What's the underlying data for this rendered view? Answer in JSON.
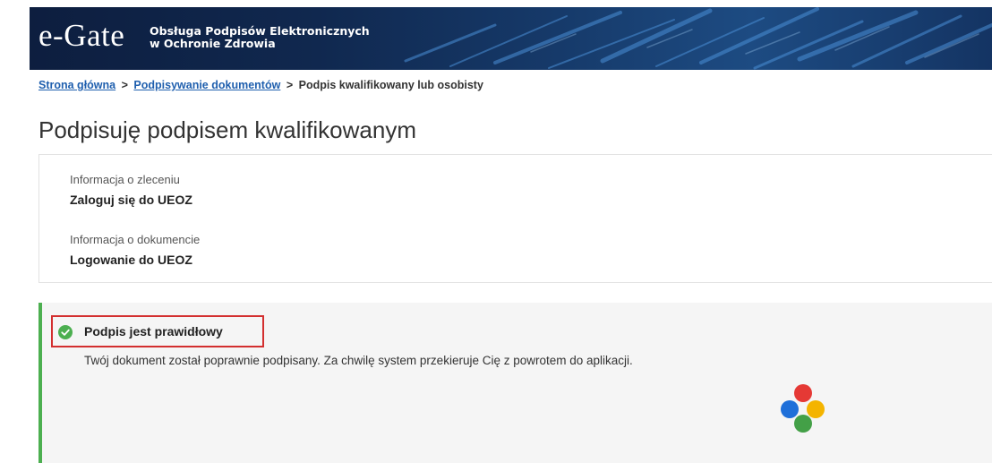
{
  "header": {
    "logo": "e-Gate",
    "subtitle_line1": "Obsługa Podpisów Elektronicznych",
    "subtitle_line2": "w Ochronie Zdrowia"
  },
  "breadcrumb": {
    "home": "Strona główna",
    "signing": "Podpisywanie dokumentów",
    "current": "Podpis kwalifikowany lub osobisty",
    "separator": ">"
  },
  "page": {
    "title": "Podpisuję podpisem kwalifikowanym"
  },
  "info": {
    "order_label": "Informacja o zleceniu",
    "order_value": "Zaloguj się do UEOZ",
    "document_label": "Informacja o dokumencie",
    "document_value": "Logowanie do UEOZ"
  },
  "status": {
    "title": "Podpis jest prawidłowy",
    "message": "Twój dokument został poprawnie podpisany. Za chwilę system przekieruje Cię z powrotem do aplikacji.",
    "icon": "check-circle-icon",
    "color": "#4caf50"
  },
  "colors": {
    "banner": "#10284f",
    "link": "#1f5fae",
    "success": "#4caf50",
    "highlight": "#d32f2f",
    "spinner_red": "#e53935",
    "spinner_blue": "#1e6fd9",
    "spinner_yellow": "#f4b400",
    "spinner_green": "#43a047"
  }
}
